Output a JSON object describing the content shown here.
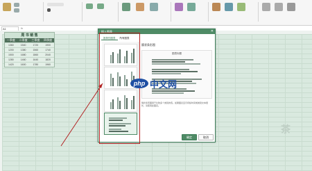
{
  "table": {
    "title": "周 书 销 售",
    "headers": [
      "一季度",
      "二季度",
      "三季度",
      "四季度"
    ],
    "rows": [
      [
        "1360",
        "1540",
        "1720",
        "1900"
      ],
      [
        "1200",
        "1380",
        "1560",
        "1740"
      ],
      [
        "1500",
        "1680",
        "1860",
        "2040"
      ],
      [
        "1280",
        "1460",
        "1640",
        "1820"
      ],
      [
        "1420",
        "1600",
        "1780",
        "1960"
      ]
    ]
  },
  "dialog": {
    "title": "插入图表",
    "tabs": [
      "推荐的图表",
      "所有图表"
    ],
    "preview_title": "簇状条形图",
    "chart_title": "图表标题",
    "note": "簇状条形图用于比较多个类别的值。如果图表显示持续时间或类别文本很长，请使用此图表。",
    "ok": "确定",
    "cancel": "取消"
  },
  "watermark": {
    "badge": "php",
    "text": "中文网"
  },
  "corner_watermark": "茶",
  "namebox": "A1",
  "fx": "fx",
  "colors": {
    "accent": "#4f8b66",
    "annotation": "#b22222",
    "watermark": "#1f4fa3"
  }
}
